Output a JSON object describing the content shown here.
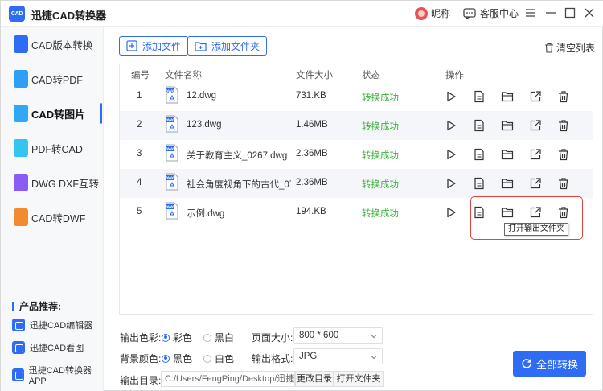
{
  "app": {
    "logo_text": "CAD",
    "title": "迅捷CAD转换器"
  },
  "titlebar": {
    "user_name": "昵称",
    "service_label": "客服中心"
  },
  "sidebar": {
    "items": [
      {
        "label": "CAD版本转换",
        "icon": "cad-version-icon",
        "color": "#2f6cf6"
      },
      {
        "label": "CAD转PDF",
        "icon": "cad-pdf-icon",
        "color": "#2f9ff6"
      },
      {
        "label": "CAD转图片",
        "icon": "cad-image-icon",
        "color": "#2fa8f6",
        "active": true
      },
      {
        "label": "PDF转CAD",
        "icon": "pdf-cad-icon",
        "color": "#35c4f0"
      },
      {
        "label": "DWG DXF互转",
        "icon": "dwg-dxf-icon",
        "color": "#8a5cf6"
      },
      {
        "label": "CAD转DWF",
        "icon": "cad-dwf-icon",
        "color": "#f28a2f"
      }
    ],
    "recommend_title": "产品推荐:",
    "recommend": [
      "迅捷CAD编辑器",
      "迅捷CAD看图",
      "迅捷CAD转换器APP"
    ]
  },
  "toolbar": {
    "add_file": "添加文件",
    "add_folder": "添加文件夹",
    "clear_list": "清空列表"
  },
  "table": {
    "headers": {
      "num": "编号",
      "name": "文件名称",
      "size": "文件大小",
      "status": "状态",
      "ops": "操作"
    },
    "rows": [
      {
        "num": "1",
        "name": "12.dwg",
        "size": "731.KB",
        "status": "转换成功"
      },
      {
        "num": "2",
        "name": "123.dwg",
        "size": "1.46MB",
        "status": "转换成功"
      },
      {
        "num": "3",
        "name": "关于教育主义_0267.dwg",
        "size": "2.36MB",
        "status": "转换成功"
      },
      {
        "num": "4",
        "name": "社会角度视角下的古代_0771....",
        "size": "2.36MB",
        "status": "转换成功"
      },
      {
        "num": "5",
        "name": "示例.dwg",
        "size": "194.KB",
        "status": "转换成功"
      }
    ],
    "file_icon_text": "DWG",
    "tooltip": "打开输出文件夹"
  },
  "settings": {
    "color_label": "输出色彩:",
    "color_options": [
      "彩色",
      "黑白"
    ],
    "page_size_label": "页面大小:",
    "page_size_value": "800 * 600",
    "bg_label": "背景颜色:",
    "bg_options": [
      "黑色",
      "白色"
    ],
    "format_label": "输出格式:",
    "format_value": "JPG",
    "dir_label": "输出目录:",
    "dir_value": "C:/Users/FengPing/Desktop/迅捷C...",
    "change_dir": "更改目录",
    "open_folder": "打开文件夹"
  },
  "convert_all": "全部转换"
}
